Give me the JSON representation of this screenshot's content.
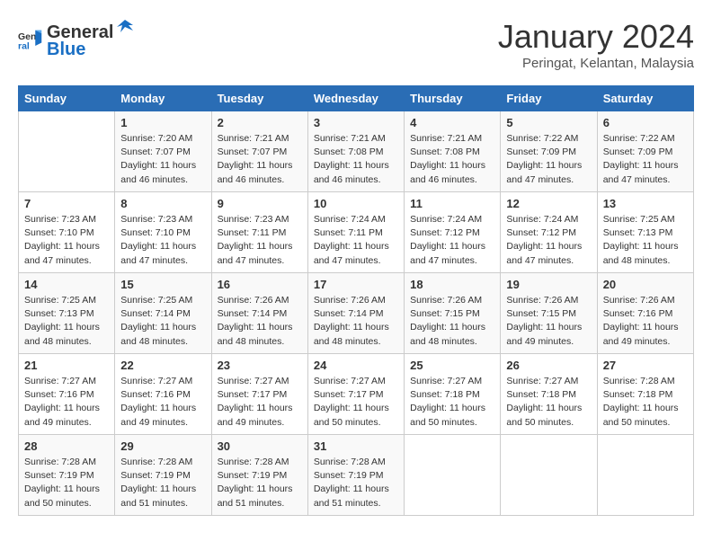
{
  "header": {
    "logo_line1": "General",
    "logo_line2": "Blue",
    "month": "January 2024",
    "location": "Peringat, Kelantan, Malaysia"
  },
  "weekdays": [
    "Sunday",
    "Monday",
    "Tuesday",
    "Wednesday",
    "Thursday",
    "Friday",
    "Saturday"
  ],
  "weeks": [
    [
      {
        "day": "",
        "info": ""
      },
      {
        "day": "1",
        "info": "Sunrise: 7:20 AM\nSunset: 7:07 PM\nDaylight: 11 hours\nand 46 minutes."
      },
      {
        "day": "2",
        "info": "Sunrise: 7:21 AM\nSunset: 7:07 PM\nDaylight: 11 hours\nand 46 minutes."
      },
      {
        "day": "3",
        "info": "Sunrise: 7:21 AM\nSunset: 7:08 PM\nDaylight: 11 hours\nand 46 minutes."
      },
      {
        "day": "4",
        "info": "Sunrise: 7:21 AM\nSunset: 7:08 PM\nDaylight: 11 hours\nand 46 minutes."
      },
      {
        "day": "5",
        "info": "Sunrise: 7:22 AM\nSunset: 7:09 PM\nDaylight: 11 hours\nand 47 minutes."
      },
      {
        "day": "6",
        "info": "Sunrise: 7:22 AM\nSunset: 7:09 PM\nDaylight: 11 hours\nand 47 minutes."
      }
    ],
    [
      {
        "day": "7",
        "info": "Sunrise: 7:23 AM\nSunset: 7:10 PM\nDaylight: 11 hours\nand 47 minutes."
      },
      {
        "day": "8",
        "info": "Sunrise: 7:23 AM\nSunset: 7:10 PM\nDaylight: 11 hours\nand 47 minutes."
      },
      {
        "day": "9",
        "info": "Sunrise: 7:23 AM\nSunset: 7:11 PM\nDaylight: 11 hours\nand 47 minutes."
      },
      {
        "day": "10",
        "info": "Sunrise: 7:24 AM\nSunset: 7:11 PM\nDaylight: 11 hours\nand 47 minutes."
      },
      {
        "day": "11",
        "info": "Sunrise: 7:24 AM\nSunset: 7:12 PM\nDaylight: 11 hours\nand 47 minutes."
      },
      {
        "day": "12",
        "info": "Sunrise: 7:24 AM\nSunset: 7:12 PM\nDaylight: 11 hours\nand 47 minutes."
      },
      {
        "day": "13",
        "info": "Sunrise: 7:25 AM\nSunset: 7:13 PM\nDaylight: 11 hours\nand 48 minutes."
      }
    ],
    [
      {
        "day": "14",
        "info": "Sunrise: 7:25 AM\nSunset: 7:13 PM\nDaylight: 11 hours\nand 48 minutes."
      },
      {
        "day": "15",
        "info": "Sunrise: 7:25 AM\nSunset: 7:14 PM\nDaylight: 11 hours\nand 48 minutes."
      },
      {
        "day": "16",
        "info": "Sunrise: 7:26 AM\nSunset: 7:14 PM\nDaylight: 11 hours\nand 48 minutes."
      },
      {
        "day": "17",
        "info": "Sunrise: 7:26 AM\nSunset: 7:14 PM\nDaylight: 11 hours\nand 48 minutes."
      },
      {
        "day": "18",
        "info": "Sunrise: 7:26 AM\nSunset: 7:15 PM\nDaylight: 11 hours\nand 48 minutes."
      },
      {
        "day": "19",
        "info": "Sunrise: 7:26 AM\nSunset: 7:15 PM\nDaylight: 11 hours\nand 49 minutes."
      },
      {
        "day": "20",
        "info": "Sunrise: 7:26 AM\nSunset: 7:16 PM\nDaylight: 11 hours\nand 49 minutes."
      }
    ],
    [
      {
        "day": "21",
        "info": "Sunrise: 7:27 AM\nSunset: 7:16 PM\nDaylight: 11 hours\nand 49 minutes."
      },
      {
        "day": "22",
        "info": "Sunrise: 7:27 AM\nSunset: 7:16 PM\nDaylight: 11 hours\nand 49 minutes."
      },
      {
        "day": "23",
        "info": "Sunrise: 7:27 AM\nSunset: 7:17 PM\nDaylight: 11 hours\nand 49 minutes."
      },
      {
        "day": "24",
        "info": "Sunrise: 7:27 AM\nSunset: 7:17 PM\nDaylight: 11 hours\nand 50 minutes."
      },
      {
        "day": "25",
        "info": "Sunrise: 7:27 AM\nSunset: 7:18 PM\nDaylight: 11 hours\nand 50 minutes."
      },
      {
        "day": "26",
        "info": "Sunrise: 7:27 AM\nSunset: 7:18 PM\nDaylight: 11 hours\nand 50 minutes."
      },
      {
        "day": "27",
        "info": "Sunrise: 7:28 AM\nSunset: 7:18 PM\nDaylight: 11 hours\nand 50 minutes."
      }
    ],
    [
      {
        "day": "28",
        "info": "Sunrise: 7:28 AM\nSunset: 7:19 PM\nDaylight: 11 hours\nand 50 minutes."
      },
      {
        "day": "29",
        "info": "Sunrise: 7:28 AM\nSunset: 7:19 PM\nDaylight: 11 hours\nand 51 minutes."
      },
      {
        "day": "30",
        "info": "Sunrise: 7:28 AM\nSunset: 7:19 PM\nDaylight: 11 hours\nand 51 minutes."
      },
      {
        "day": "31",
        "info": "Sunrise: 7:28 AM\nSunset: 7:19 PM\nDaylight: 11 hours\nand 51 minutes."
      },
      {
        "day": "",
        "info": ""
      },
      {
        "day": "",
        "info": ""
      },
      {
        "day": "",
        "info": ""
      }
    ]
  ]
}
